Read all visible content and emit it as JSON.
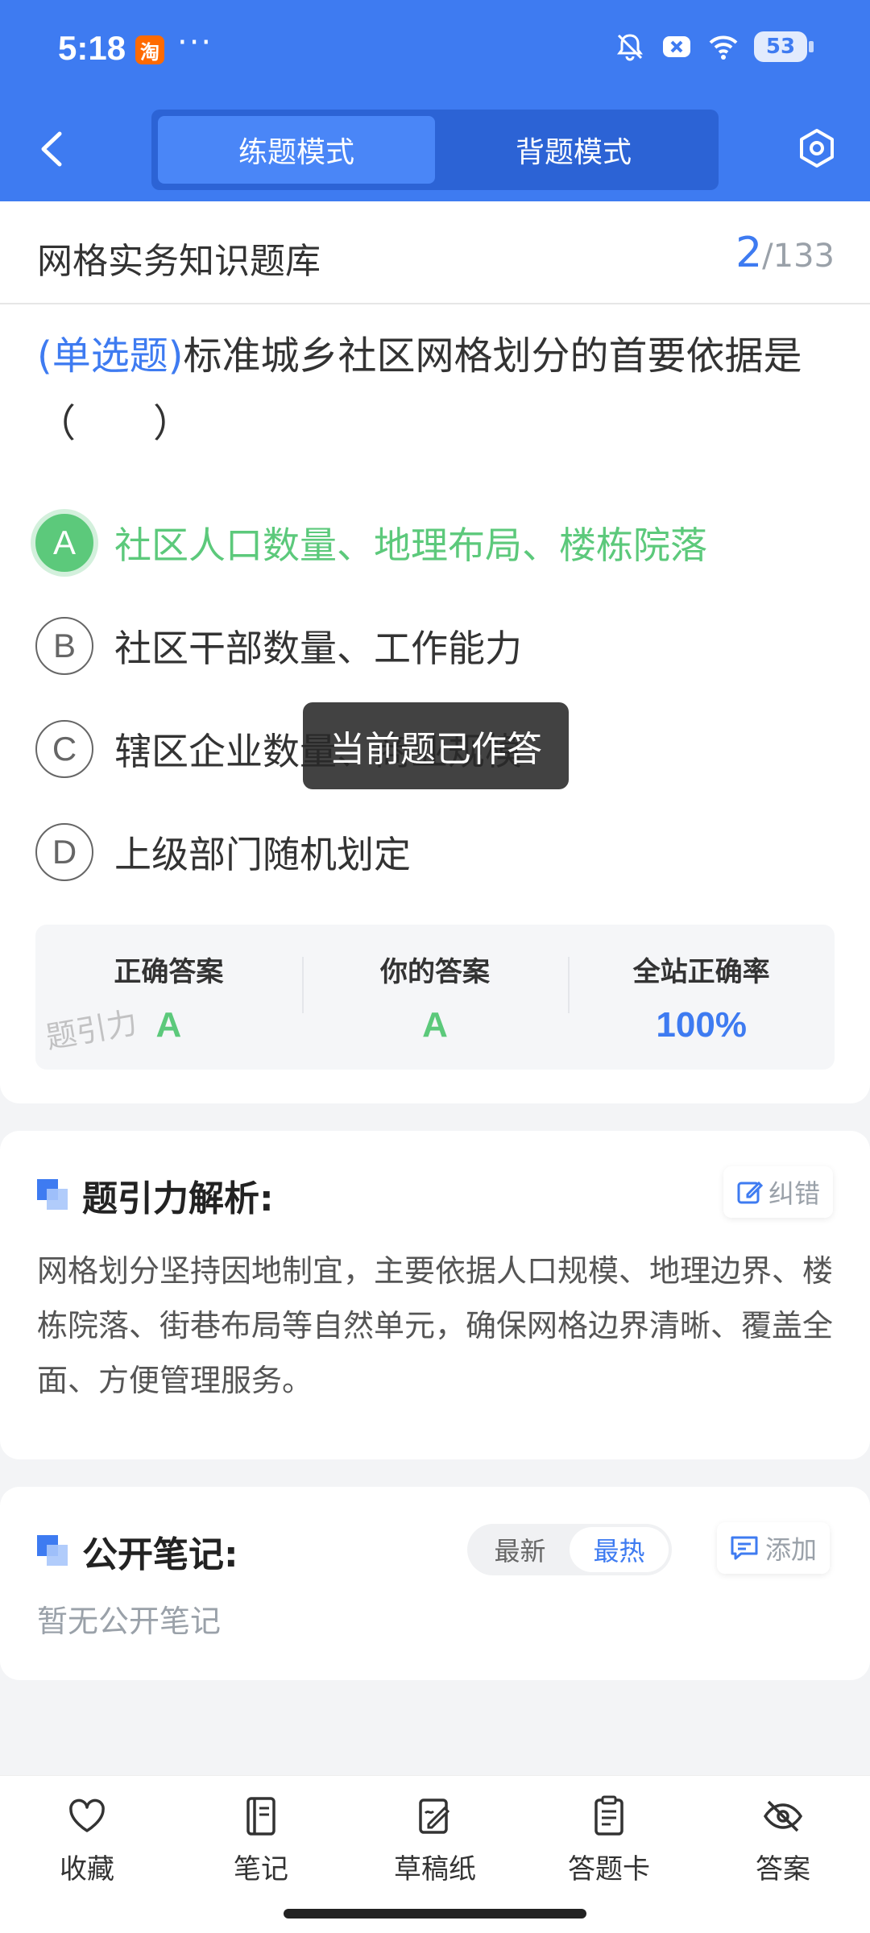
{
  "status_bar": {
    "time": "5:18",
    "app_icon": "淘",
    "more": "···",
    "battery": "53"
  },
  "header": {
    "tabs": [
      {
        "label": "练题模式",
        "active": true
      },
      {
        "label": "背题模式",
        "active": false
      }
    ]
  },
  "bank": {
    "title": "网格实务知识题库",
    "current": "2",
    "total": "/133"
  },
  "question": {
    "type": "(单选题)",
    "text": "标准城乡社区网格划分的首要依据是（　　）"
  },
  "options": [
    {
      "letter": "A",
      "text": "社区人口数量、地理布局、楼栋院落",
      "correct": true
    },
    {
      "letter": "B",
      "text": "社区干部数量、工作能力"
    },
    {
      "letter": "C",
      "text": "辖区企业数量、商业规模"
    },
    {
      "letter": "D",
      "text": "上级部门随机划定"
    }
  ],
  "answer_box": {
    "correct_label": "正确答案",
    "correct_value": "A",
    "yours_label": "你的答案",
    "yours_value": "A",
    "rate_label": "全站正确率",
    "rate_value": "100%",
    "watermark": "题引力"
  },
  "toast": "当前题已作答",
  "analysis": {
    "title": "题引力解析:",
    "correct_button": "纠错",
    "text": "网格划分坚持因地制宜，主要依据人口规模、地理边界、楼栋院落、街巷布局等自然单元，确保网格边界清晰、覆盖全面、方便管理服务。"
  },
  "notes": {
    "title": "公开笔记:",
    "sort_latest": "最新",
    "sort_hot": "最热",
    "add_button": "添加",
    "empty": "暂无公开笔记"
  },
  "bottom_bar": [
    {
      "label": "收藏",
      "icon": "heart-icon"
    },
    {
      "label": "笔记",
      "icon": "notebook-icon"
    },
    {
      "label": "草稿纸",
      "icon": "draft-icon"
    },
    {
      "label": "答题卡",
      "icon": "answer-card-icon"
    },
    {
      "label": "答案",
      "icon": "eye-off-icon"
    }
  ],
  "colors": {
    "primary": "#3e7bf1",
    "correct": "#5cc97b"
  }
}
